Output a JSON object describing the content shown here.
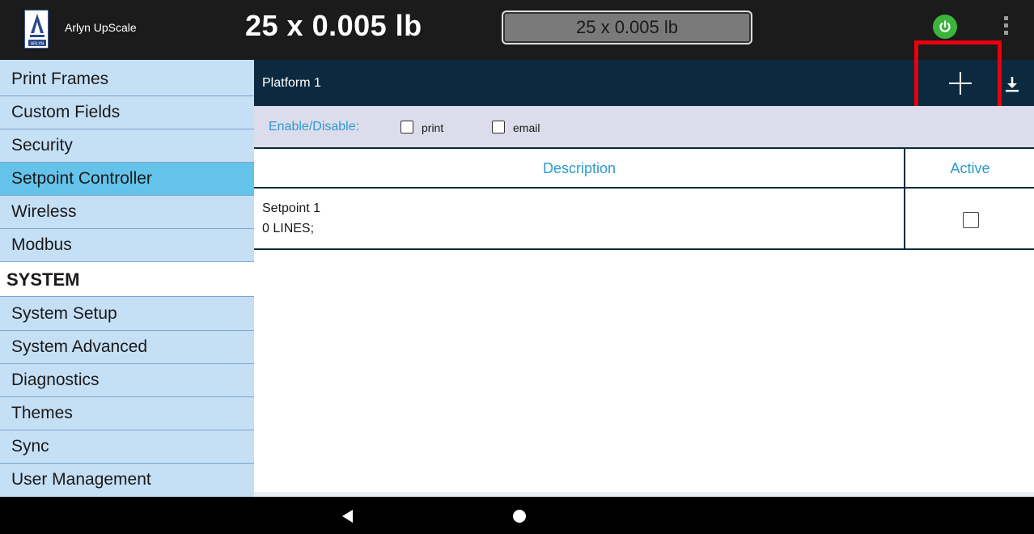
{
  "app": {
    "name": "Arlyn UpScale",
    "logo_text": "ARLYN"
  },
  "header": {
    "weight_display": "25 x 0.005 lb",
    "weight_box": "25 x 0.005 lb"
  },
  "sidebar": {
    "items": [
      {
        "label": "Print Frames"
      },
      {
        "label": "Custom Fields"
      },
      {
        "label": "Security"
      },
      {
        "label": "Setpoint Controller",
        "selected": true
      },
      {
        "label": "Wireless"
      },
      {
        "label": "Modbus"
      }
    ],
    "section_header": "SYSTEM",
    "system_items": [
      {
        "label": "System Setup"
      },
      {
        "label": "System Advanced"
      },
      {
        "label": "Diagnostics"
      },
      {
        "label": "Themes"
      },
      {
        "label": "Sync"
      },
      {
        "label": "User Management"
      }
    ]
  },
  "main": {
    "platform_title": "Platform 1",
    "enable_label": "Enable/Disable:",
    "print_label": "print",
    "email_label": "email",
    "table": {
      "columns": [
        "Description",
        "Active"
      ],
      "rows": [
        {
          "name": "Setpoint 1",
          "detail": "0 LINES;",
          "active": false
        }
      ]
    }
  },
  "colors": {
    "topbar": "#1b1b1b",
    "sidebar_bg": "#c5dff5",
    "sidebar_selected": "#63c3ea",
    "platform_bar": "#0b2a3f",
    "accent_blue": "#2a9bd0",
    "highlight": "#e8000d",
    "power_green": "#3cb43c"
  },
  "icons": [
    "arlyn-logo-icon",
    "power-icon",
    "overflow-menu-icon",
    "add-icon",
    "download-icon",
    "back-icon",
    "home-icon"
  ]
}
